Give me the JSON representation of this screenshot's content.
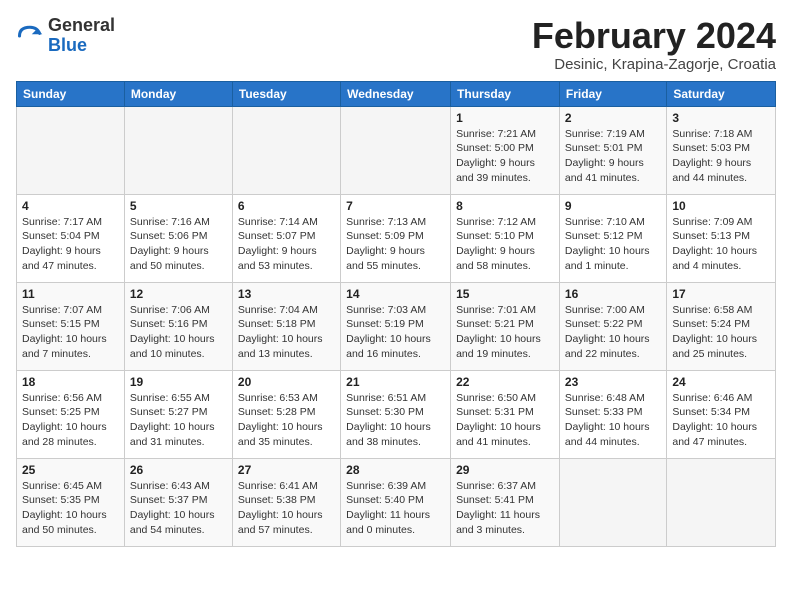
{
  "header": {
    "logo_general": "General",
    "logo_blue": "Blue",
    "month_year": "February 2024",
    "location": "Desinic, Krapina-Zagorje, Croatia"
  },
  "days_of_week": [
    "Sunday",
    "Monday",
    "Tuesday",
    "Wednesday",
    "Thursday",
    "Friday",
    "Saturday"
  ],
  "weeks": [
    [
      {
        "day": "",
        "info": ""
      },
      {
        "day": "",
        "info": ""
      },
      {
        "day": "",
        "info": ""
      },
      {
        "day": "",
        "info": ""
      },
      {
        "day": "1",
        "info": "Sunrise: 7:21 AM\nSunset: 5:00 PM\nDaylight: 9 hours\nand 39 minutes."
      },
      {
        "day": "2",
        "info": "Sunrise: 7:19 AM\nSunset: 5:01 PM\nDaylight: 9 hours\nand 41 minutes."
      },
      {
        "day": "3",
        "info": "Sunrise: 7:18 AM\nSunset: 5:03 PM\nDaylight: 9 hours\nand 44 minutes."
      }
    ],
    [
      {
        "day": "4",
        "info": "Sunrise: 7:17 AM\nSunset: 5:04 PM\nDaylight: 9 hours\nand 47 minutes."
      },
      {
        "day": "5",
        "info": "Sunrise: 7:16 AM\nSunset: 5:06 PM\nDaylight: 9 hours\nand 50 minutes."
      },
      {
        "day": "6",
        "info": "Sunrise: 7:14 AM\nSunset: 5:07 PM\nDaylight: 9 hours\nand 53 minutes."
      },
      {
        "day": "7",
        "info": "Sunrise: 7:13 AM\nSunset: 5:09 PM\nDaylight: 9 hours\nand 55 minutes."
      },
      {
        "day": "8",
        "info": "Sunrise: 7:12 AM\nSunset: 5:10 PM\nDaylight: 9 hours\nand 58 minutes."
      },
      {
        "day": "9",
        "info": "Sunrise: 7:10 AM\nSunset: 5:12 PM\nDaylight: 10 hours\nand 1 minute."
      },
      {
        "day": "10",
        "info": "Sunrise: 7:09 AM\nSunset: 5:13 PM\nDaylight: 10 hours\nand 4 minutes."
      }
    ],
    [
      {
        "day": "11",
        "info": "Sunrise: 7:07 AM\nSunset: 5:15 PM\nDaylight: 10 hours\nand 7 minutes."
      },
      {
        "day": "12",
        "info": "Sunrise: 7:06 AM\nSunset: 5:16 PM\nDaylight: 10 hours\nand 10 minutes."
      },
      {
        "day": "13",
        "info": "Sunrise: 7:04 AM\nSunset: 5:18 PM\nDaylight: 10 hours\nand 13 minutes."
      },
      {
        "day": "14",
        "info": "Sunrise: 7:03 AM\nSunset: 5:19 PM\nDaylight: 10 hours\nand 16 minutes."
      },
      {
        "day": "15",
        "info": "Sunrise: 7:01 AM\nSunset: 5:21 PM\nDaylight: 10 hours\nand 19 minutes."
      },
      {
        "day": "16",
        "info": "Sunrise: 7:00 AM\nSunset: 5:22 PM\nDaylight: 10 hours\nand 22 minutes."
      },
      {
        "day": "17",
        "info": "Sunrise: 6:58 AM\nSunset: 5:24 PM\nDaylight: 10 hours\nand 25 minutes."
      }
    ],
    [
      {
        "day": "18",
        "info": "Sunrise: 6:56 AM\nSunset: 5:25 PM\nDaylight: 10 hours\nand 28 minutes."
      },
      {
        "day": "19",
        "info": "Sunrise: 6:55 AM\nSunset: 5:27 PM\nDaylight: 10 hours\nand 31 minutes."
      },
      {
        "day": "20",
        "info": "Sunrise: 6:53 AM\nSunset: 5:28 PM\nDaylight: 10 hours\nand 35 minutes."
      },
      {
        "day": "21",
        "info": "Sunrise: 6:51 AM\nSunset: 5:30 PM\nDaylight: 10 hours\nand 38 minutes."
      },
      {
        "day": "22",
        "info": "Sunrise: 6:50 AM\nSunset: 5:31 PM\nDaylight: 10 hours\nand 41 minutes."
      },
      {
        "day": "23",
        "info": "Sunrise: 6:48 AM\nSunset: 5:33 PM\nDaylight: 10 hours\nand 44 minutes."
      },
      {
        "day": "24",
        "info": "Sunrise: 6:46 AM\nSunset: 5:34 PM\nDaylight: 10 hours\nand 47 minutes."
      }
    ],
    [
      {
        "day": "25",
        "info": "Sunrise: 6:45 AM\nSunset: 5:35 PM\nDaylight: 10 hours\nand 50 minutes."
      },
      {
        "day": "26",
        "info": "Sunrise: 6:43 AM\nSunset: 5:37 PM\nDaylight: 10 hours\nand 54 minutes."
      },
      {
        "day": "27",
        "info": "Sunrise: 6:41 AM\nSunset: 5:38 PM\nDaylight: 10 hours\nand 57 minutes."
      },
      {
        "day": "28",
        "info": "Sunrise: 6:39 AM\nSunset: 5:40 PM\nDaylight: 11 hours\nand 0 minutes."
      },
      {
        "day": "29",
        "info": "Sunrise: 6:37 AM\nSunset: 5:41 PM\nDaylight: 11 hours\nand 3 minutes."
      },
      {
        "day": "",
        "info": ""
      },
      {
        "day": "",
        "info": ""
      }
    ]
  ]
}
